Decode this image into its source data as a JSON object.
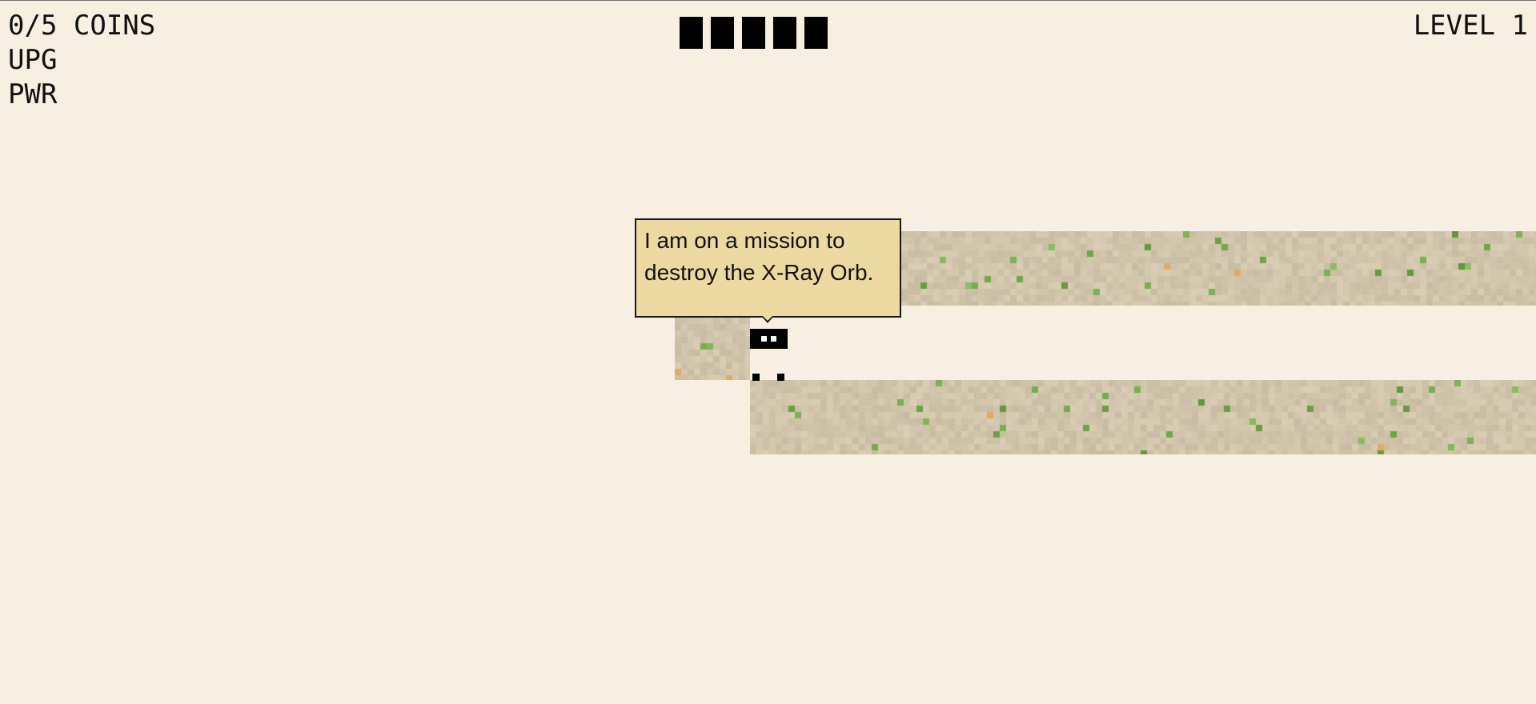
{
  "hud": {
    "coins_text": "0/5 COINS",
    "upg_label": "UPG",
    "pwr_label": "PWR",
    "level_text": "LEVEL 1",
    "health_blocks": 5
  },
  "dialogue": {
    "text": "I am on a mission to destroy the X-Ray Orb."
  },
  "icons": {
    "player": "player-character-icon",
    "health": "health-block-icon"
  },
  "colors": {
    "background": "#f8efe3",
    "terrain_base": "#cdbfa3",
    "terrain_moss": "#7d9a4e",
    "terrain_accent": "#e3a45a",
    "bubble": "#ecd9a2",
    "player": "#000000"
  }
}
